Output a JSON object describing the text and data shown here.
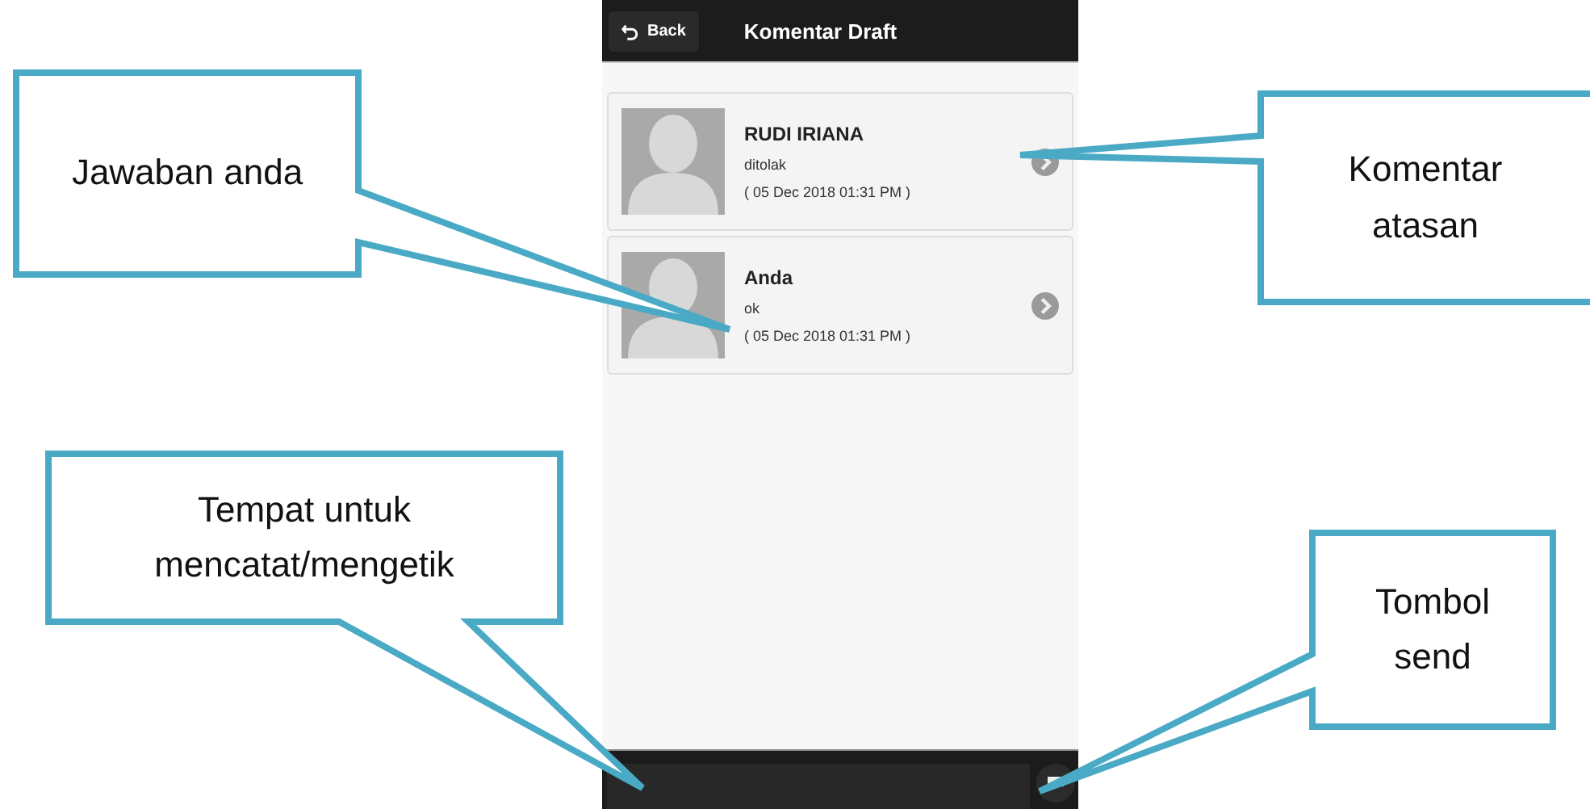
{
  "header": {
    "back_label": "Back",
    "title": "Komentar Draft"
  },
  "comments": [
    {
      "name": "RUDI IRIANA",
      "message": "ditolak",
      "time": "( 05 Dec 2018 01:31 PM )"
    },
    {
      "name": "Anda",
      "message": "ok",
      "time": "( 05 Dec 2018 01:31 PM )"
    }
  ],
  "callouts": [
    {
      "text": "Jawaban anda"
    },
    {
      "text": "Komentar atasan"
    },
    {
      "text": "Tempat untuk mencatat/mengetik"
    },
    {
      "text": "Tombol send"
    }
  ]
}
